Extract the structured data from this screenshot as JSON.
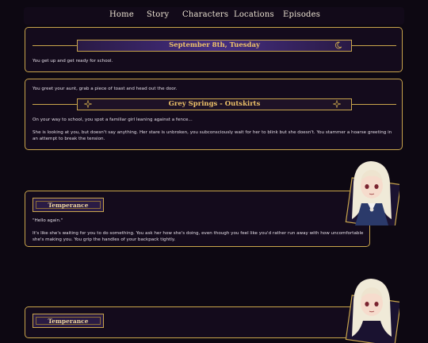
{
  "nav": {
    "items": [
      "Home",
      "Story",
      "Characters",
      "Locations",
      "Episodes"
    ]
  },
  "scene1": {
    "date": "September 8th, Tuesday",
    "text1": "You get up and get ready for school."
  },
  "scene2": {
    "intro": "You greet your aunt, grab a piece of toast and head out the door.",
    "location": "Grey Springs - Outskirts",
    "text1": "On your way to school, you spot a familiar girl leaning against a fence...",
    "text2": "She is looking at you, but doesn't say anything. Her stare is unbroken, you subconsciously wait for her to blink but she doesn't. You stammer a hoarse greeting in an attempt to break the tension."
  },
  "dialogue1": {
    "speaker": "Temperance",
    "line": "\"Hello again.\"",
    "narration": "It's like she's waiting for you to do something. You ask her how she's doing, even though you feel like you'd rather run away with how uncomfortable she's making you. You grip the handles of your backpack tightly."
  },
  "dialogue2": {
    "speaker": "Temperance"
  },
  "colors": {
    "background": "#0d0812",
    "panel": "#140b1c",
    "gold": "#c9a54c",
    "banner_purple": "#452e82",
    "text": "#e3dce6"
  }
}
